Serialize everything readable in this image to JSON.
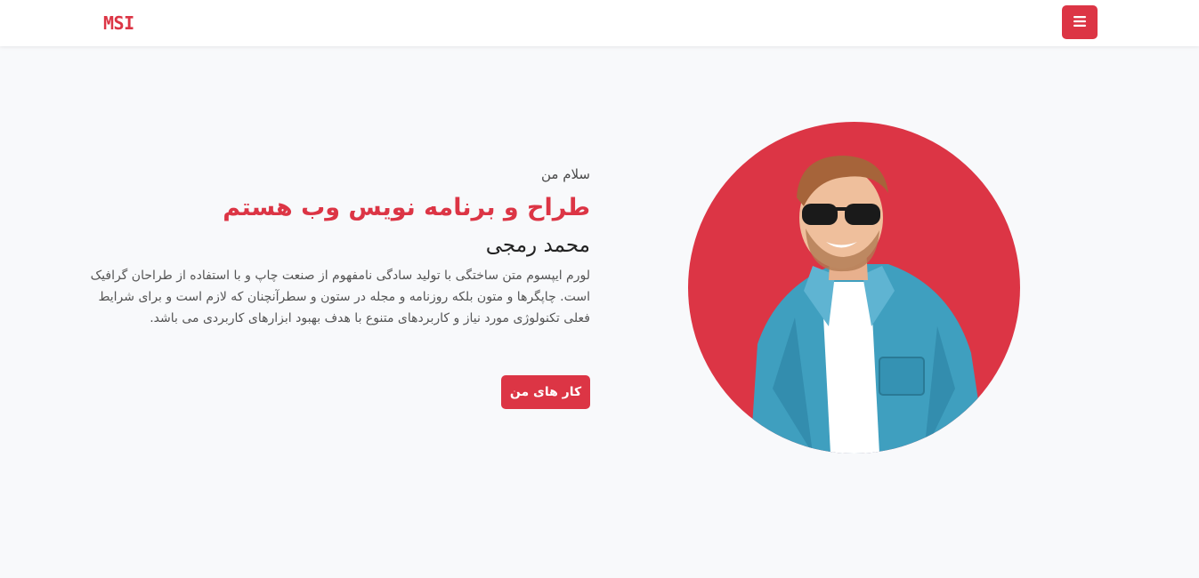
{
  "navbar": {
    "brand": "MSI",
    "menu_icon": "hamburger-menu-icon"
  },
  "hero": {
    "greeting": "سلام من",
    "title": "طراح و برنامه نویس وب هستم",
    "name": "محمد رمجی",
    "description": "لورم ایپسوم متن ساختگی با تولید سادگی نامفهوم از صنعت چاپ و با استفاده از طراحان گرافیک است. چاپگرها و متون بلکه روزنامه و مجله در ستون و سطرآنچنان که لازم است و برای شرایط فعلی تکنولوژی مورد نیاز و کاربردهای متنوع با هدف بهبود ابزارهای کاربردی می باشد.",
    "cta_label": "کار های من"
  },
  "portrait": {
    "description_icon": "profile-photo",
    "circle_color": "#dc3545"
  },
  "colors": {
    "accent": "#dc3545",
    "background": "#f8f9fb"
  }
}
